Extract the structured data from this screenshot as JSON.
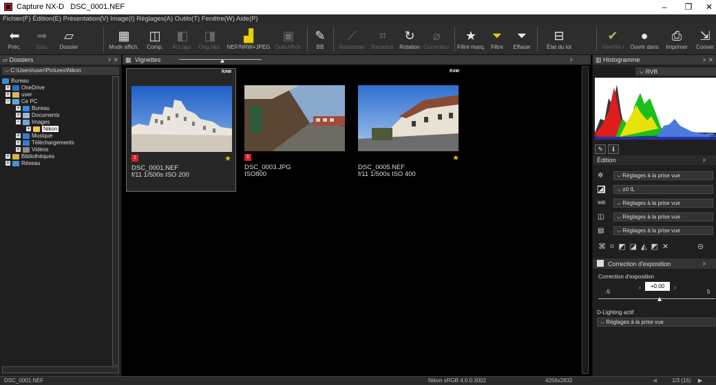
{
  "window": {
    "app_name": "Capture NX-D",
    "file": "DSC_0001.NEF"
  },
  "menu": [
    "Fichier(F)",
    "Édition(E)",
    "Présentation(V)",
    "Image(I)",
    "Réglages(A)",
    "Outils(T)",
    "Fenêtre(W)",
    "Aide(P)"
  ],
  "toolbar": {
    "prev": "Préc.",
    "next": "Suiv.",
    "folder": "Dossier",
    "view_mode": "Mode affich.",
    "compare": "Comp.",
    "after": "Act./apr.",
    "orig": "Orig./apr.",
    "nef": "NEF/NRW+JPEG",
    "display_tool": "Outil Affich.",
    "bb": "BB",
    "straighten": "Redresser",
    "crop": "Recadrer",
    "rotate": "Rotation",
    "retouch": "Correcteur",
    "rate": "Filtre marq.",
    "filter": "Filtre",
    "clear": "Effacer",
    "batch": "État du lot",
    "viewnx": "ViewNX-i",
    "open_in": "Ouvrir dans",
    "print": "Imprimer",
    "convert": "Conver"
  },
  "left_panel": {
    "title": "Dossiers",
    "path": "C:\\Users\\user\\Pictures\\Nikon",
    "tree": [
      {
        "label": "Bureau"
      },
      {
        "label": "OneDrive"
      },
      {
        "label": "user"
      },
      {
        "label": "Ce PC"
      },
      {
        "label": "Bureau"
      },
      {
        "label": "Documents"
      },
      {
        "label": "Images"
      },
      {
        "label": "Nikon"
      },
      {
        "label": "Musique"
      },
      {
        "label": "Téléchargements"
      },
      {
        "label": "Vidéos"
      },
      {
        "label": "Bibliothèques"
      },
      {
        "label": "Réseau"
      }
    ]
  },
  "center": {
    "title": "Vignettes",
    "thumbnails": [
      {
        "name": "DSC_0001.NEF",
        "info": "f/11 1/500s ISO 200",
        "raw": "RAW",
        "flag": "1",
        "rating": 1
      },
      {
        "name": "DSC_0003.JPG",
        "info": "ISO800",
        "raw": "",
        "flag": "1",
        "rating": 0
      },
      {
        "name": "DSC_0005.NEF",
        "info": "f/11 1/500s ISO 400",
        "raw": "RAW",
        "flag": "",
        "rating": 1
      }
    ]
  },
  "right_panel": {
    "histogram_title": "Histogramme",
    "channel": "RVB",
    "hist_min": "0",
    "hist_max": "25",
    "edit_title": "Édition",
    "edit_rows": [
      "Réglages à la prise vue",
      "±0 IL",
      "Réglages à la prise vue",
      "Réglages à la prise vue",
      "Réglages à la prise vue"
    ],
    "exposure_title": "Correction d'exposition",
    "exposure_label": "Correction d'exposition",
    "exposure_value": "+0.00",
    "exposure_min": "-5",
    "exposure_max": "5",
    "dlighting_label": "D-Lighting actif",
    "dlighting_value": "Réglages à la prise vue"
  },
  "status": {
    "file": "DSC_0001.NEF",
    "profile": "Nikon sRGB 4.0.0.3002",
    "size": "4256x2832",
    "page": "1/3 (15)"
  },
  "colors": {
    "accent": "#c0102b",
    "flag": "#d8232a",
    "star": "#e6c200",
    "filter": "#e8d000"
  }
}
